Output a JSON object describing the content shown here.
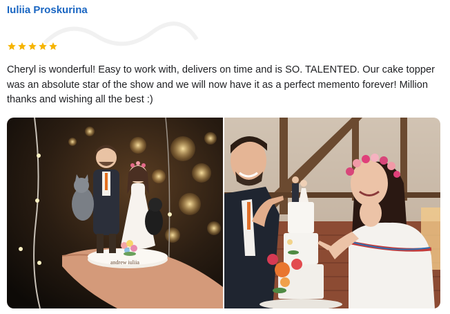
{
  "review": {
    "author_name": "Iuliia Proskurina",
    "rating": 5,
    "star_icon": "star-icon",
    "star_color": "#f6b400",
    "author_color": "#1a66c2",
    "text": "Cheryl is wonderful! Easy to work with, delivers on time and is SO. TALENTED. Our cake topper was an absolute star of the show and we will now have it as a perfect memento forever! Million thanks and wishing all the best :)",
    "photos": [
      {
        "name": "cake-topper-in-hand-photo",
        "base_text": "andrew   iuliia"
      },
      {
        "name": "couple-with-wedding-cake-photo"
      }
    ]
  }
}
